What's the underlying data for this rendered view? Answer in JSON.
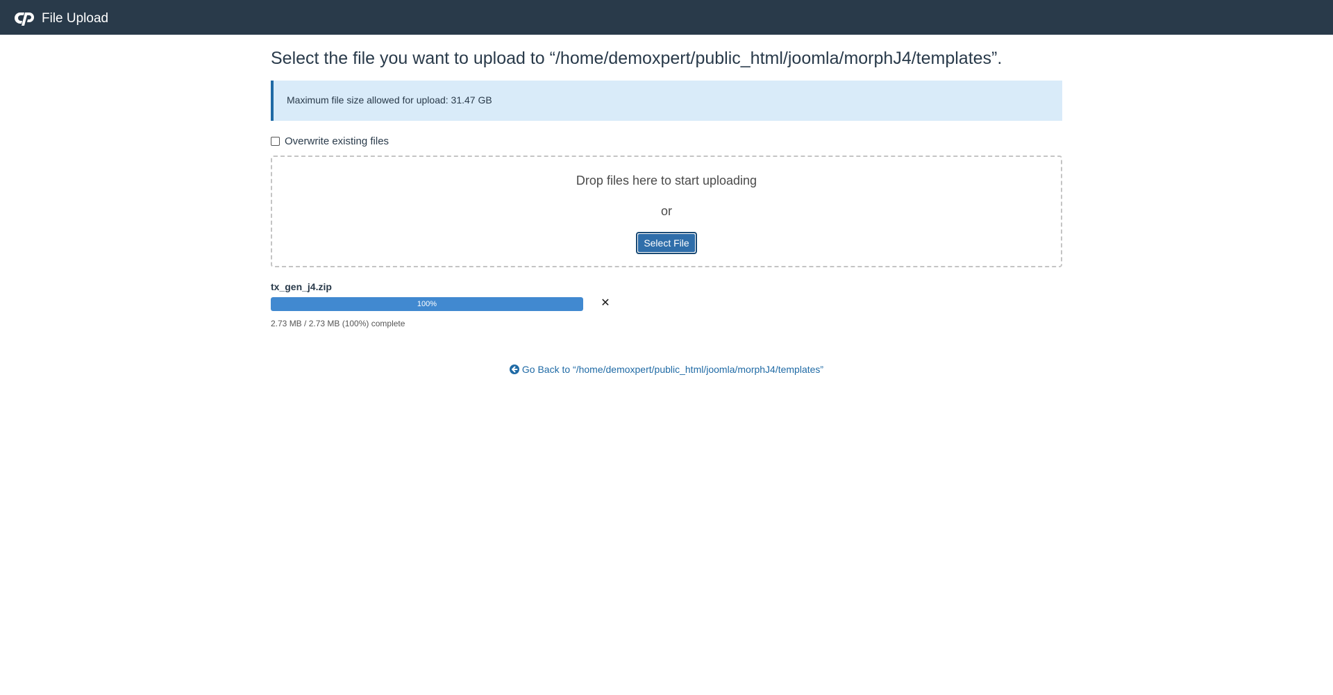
{
  "header": {
    "title": "File Upload",
    "logo_icon": "cpanel-logo-icon"
  },
  "main": {
    "heading": "Select the file you want to upload to “/home/demoxpert/public_html/joomla/morphJ4/templates”.",
    "info": "Maximum file size allowed for upload: 31.47 GB",
    "overwrite_label": "Overwrite existing files",
    "overwrite_checked": false,
    "drop_text": "Drop files here to start uploading",
    "or_text": "or",
    "select_button": "Select File",
    "uploads": [
      {
        "file_name": "tx_gen_j4.zip",
        "progress": 100,
        "progress_label": "100%",
        "status": "2.73 MB / 2.73 MB (100%) complete",
        "remove_icon": "close-icon"
      }
    ],
    "back_link": "Go Back to “/home/demoxpert/public_html/joomla/morphJ4/templates”",
    "back_icon": "arrow-circle-left-icon"
  },
  "colors": {
    "header_bg": "#293a4a",
    "info_bg": "#d9ebf9",
    "accent": "#1f6aa5",
    "progress": "#4189d0"
  }
}
